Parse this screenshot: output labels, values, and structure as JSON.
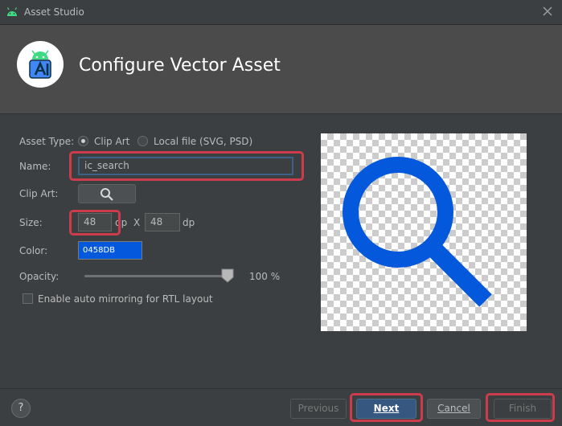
{
  "window": {
    "title": "Asset Studio",
    "close_icon": "close-icon",
    "app_icon": "android-icon"
  },
  "header": {
    "title": "Configure Vector Asset",
    "logo_icon": "android-studio-logo"
  },
  "form": {
    "asset_type": {
      "label": "Asset Type:",
      "options": [
        "Clip Art",
        "Local file (SVG, PSD)"
      ],
      "selected": "Clip Art"
    },
    "name": {
      "label": "Name:",
      "value": "ic_search"
    },
    "clip_art": {
      "label": "Clip Art:",
      "icon": "search-icon"
    },
    "size": {
      "label": "Size:",
      "width": "48",
      "height": "48",
      "unit": "dp",
      "separator": "X"
    },
    "color": {
      "label": "Color:",
      "value": "0458DB",
      "swatch": "#0458db"
    },
    "opacity": {
      "label": "Opacity:",
      "value": 100,
      "display": "100 %"
    },
    "rtl": {
      "label": "Enable auto mirroring for RTL layout",
      "checked": false
    }
  },
  "preview": {
    "icon": "search-icon",
    "color": "#0458db"
  },
  "footer": {
    "help": "?",
    "previous": "Previous",
    "next": "Next",
    "cancel": "Cancel",
    "finish": "Finish"
  },
  "colors": {
    "highlight": "#cc3c4a",
    "primary_button": "#365880",
    "background": "#3c3f41"
  }
}
